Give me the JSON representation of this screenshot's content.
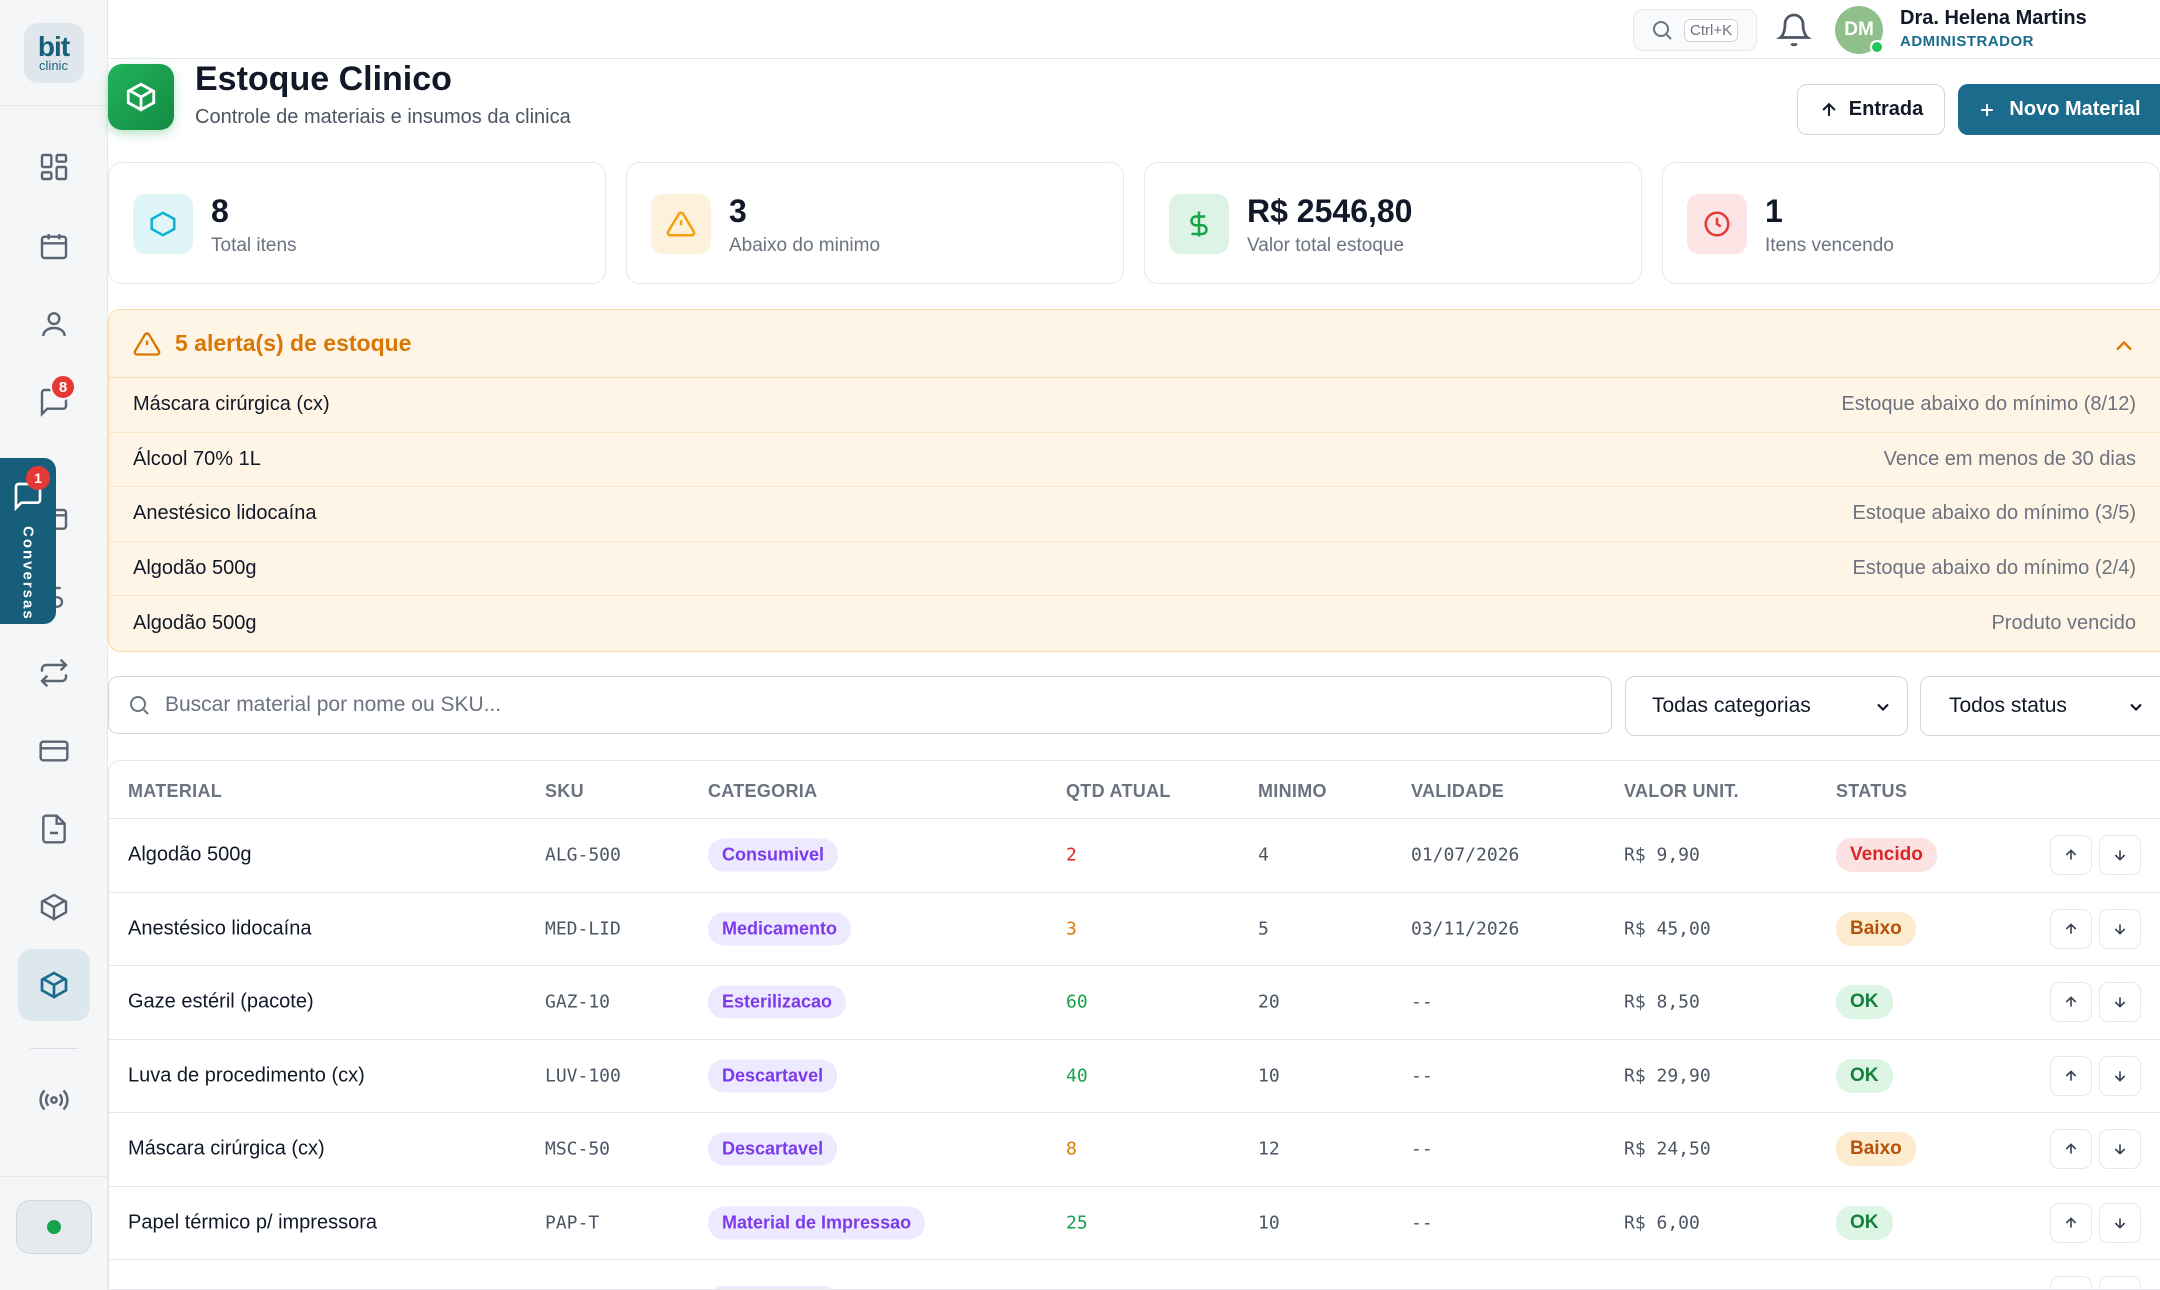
{
  "app": {
    "logo_top": "bit",
    "logo_bottom": "clinic"
  },
  "sidebar": {
    "items": [
      {
        "name": "dashboard",
        "icon": "grid-icon"
      },
      {
        "name": "calendar",
        "icon": "calendar-icon"
      },
      {
        "name": "patients",
        "icon": "user-icon"
      },
      {
        "name": "messages",
        "icon": "chat-icon",
        "badge": "8"
      },
      {
        "name": "cashier",
        "icon": "wallet-icon"
      },
      {
        "name": "finance",
        "icon": "dollar-icon"
      },
      {
        "name": "transfers",
        "icon": "repeat-icon"
      },
      {
        "name": "payments",
        "icon": "card-icon"
      },
      {
        "name": "documents",
        "icon": "file-icon"
      },
      {
        "name": "products",
        "icon": "box-icon"
      },
      {
        "name": "inventory",
        "icon": "box-icon",
        "active": true
      },
      {
        "name": "broadcast",
        "icon": "broadcast-icon"
      }
    ]
  },
  "conversas": {
    "badge": "1",
    "label": "Conversas"
  },
  "topbar": {
    "search_shortcut": "Ctrl+K",
    "user": {
      "initials": "DM",
      "name": "Dra. Helena Martins",
      "role": "ADMINISTRADOR"
    }
  },
  "header": {
    "title": "Estoque Clinico",
    "subtitle": "Controle de materiais e insumos da clinica",
    "btn_entrada": "Entrada",
    "btn_novo": "Novo Material"
  },
  "stats": [
    {
      "value": "8",
      "label": "Total itens",
      "color": "#06b6d4",
      "bg": "#e0f5f8"
    },
    {
      "value": "3",
      "label": "Abaixo do minimo",
      "color": "#f59e0b",
      "bg": "#fdf1dc"
    },
    {
      "value": "R$ 2546,80",
      "label": "Valor total estoque",
      "color": "#16a34a",
      "bg": "#ddf3e6"
    },
    {
      "value": "1",
      "label": "Itens vencendo",
      "color": "#e53935",
      "bg": "#fde4e4"
    }
  ],
  "alerts": {
    "title": "5 alerta(s) de estoque",
    "items": [
      {
        "name": "Máscara cirúrgica (cx)",
        "msg": "Estoque abaixo do mínimo (8/12)"
      },
      {
        "name": "Álcool 70% 1L",
        "msg": "Vence em menos de 30 dias"
      },
      {
        "name": "Anestésico lidocaína",
        "msg": "Estoque abaixo do mínimo (3/5)"
      },
      {
        "name": "Algodão 500g",
        "msg": "Estoque abaixo do mínimo (2/4)"
      },
      {
        "name": "Algodão 500g",
        "msg": "Produto vencido"
      }
    ]
  },
  "filters": {
    "search_placeholder": "Buscar material por nome ou SKU...",
    "category": "Todas categorias",
    "status": "Todos status"
  },
  "table": {
    "headers": {
      "material": "MATERIAL",
      "sku": "SKU",
      "categoria": "CATEGORIA",
      "qtd": "QTD ATUAL",
      "minimo": "MINIMO",
      "validade": "VALIDADE",
      "valor": "VALOR UNIT.",
      "status": "STATUS"
    },
    "rows": [
      {
        "material": "Algodão 500g",
        "sku": "ALG-500",
        "categoria": "Consumivel",
        "qtd": "2",
        "qtd_color": "#dc2626",
        "minimo": "4",
        "validade": "01/07/2026",
        "valor": "R$ 9,90",
        "status": "Vencido",
        "status_color": "#dc2626",
        "status_bg": "#fde2e2"
      },
      {
        "material": "Anestésico lidocaína",
        "sku": "MED-LID",
        "categoria": "Medicamento",
        "qtd": "3",
        "qtd_color": "#d97706",
        "minimo": "5",
        "validade": "03/11/2026",
        "valor": "R$ 45,00",
        "status": "Baixo",
        "status_color": "#b45309",
        "status_bg": "#fdebd0"
      },
      {
        "material": "Gaze estéril (pacote)",
        "sku": "GAZ-10",
        "categoria": "Esterilizacao",
        "qtd": "60",
        "qtd_color": "#16a34a",
        "minimo": "20",
        "validade": "--",
        "valor": "R$ 8,50",
        "status": "OK",
        "status_color": "#15803d",
        "status_bg": "#dcf5e5"
      },
      {
        "material": "Luva de procedimento (cx)",
        "sku": "LUV-100",
        "categoria": "Descartavel",
        "qtd": "40",
        "qtd_color": "#16a34a",
        "minimo": "10",
        "validade": "--",
        "valor": "R$ 29,90",
        "status": "OK",
        "status_color": "#15803d",
        "status_bg": "#dcf5e5"
      },
      {
        "material": "Máscara cirúrgica (cx)",
        "sku": "MSC-50",
        "categoria": "Descartavel",
        "qtd": "8",
        "qtd_color": "#d97706",
        "minimo": "12",
        "validade": "--",
        "valor": "R$ 24,50",
        "status": "Baixo",
        "status_color": "#b45309",
        "status_bg": "#fdebd0"
      },
      {
        "material": "Papel térmico p/ impressora",
        "sku": "PAP-T",
        "categoria": "Material de Impressao",
        "qtd": "25",
        "qtd_color": "#16a34a",
        "minimo": "10",
        "validade": "--",
        "valor": "R$ 6,00",
        "status": "OK",
        "status_color": "#15803d",
        "status_bg": "#dcf5e5"
      }
    ]
  }
}
